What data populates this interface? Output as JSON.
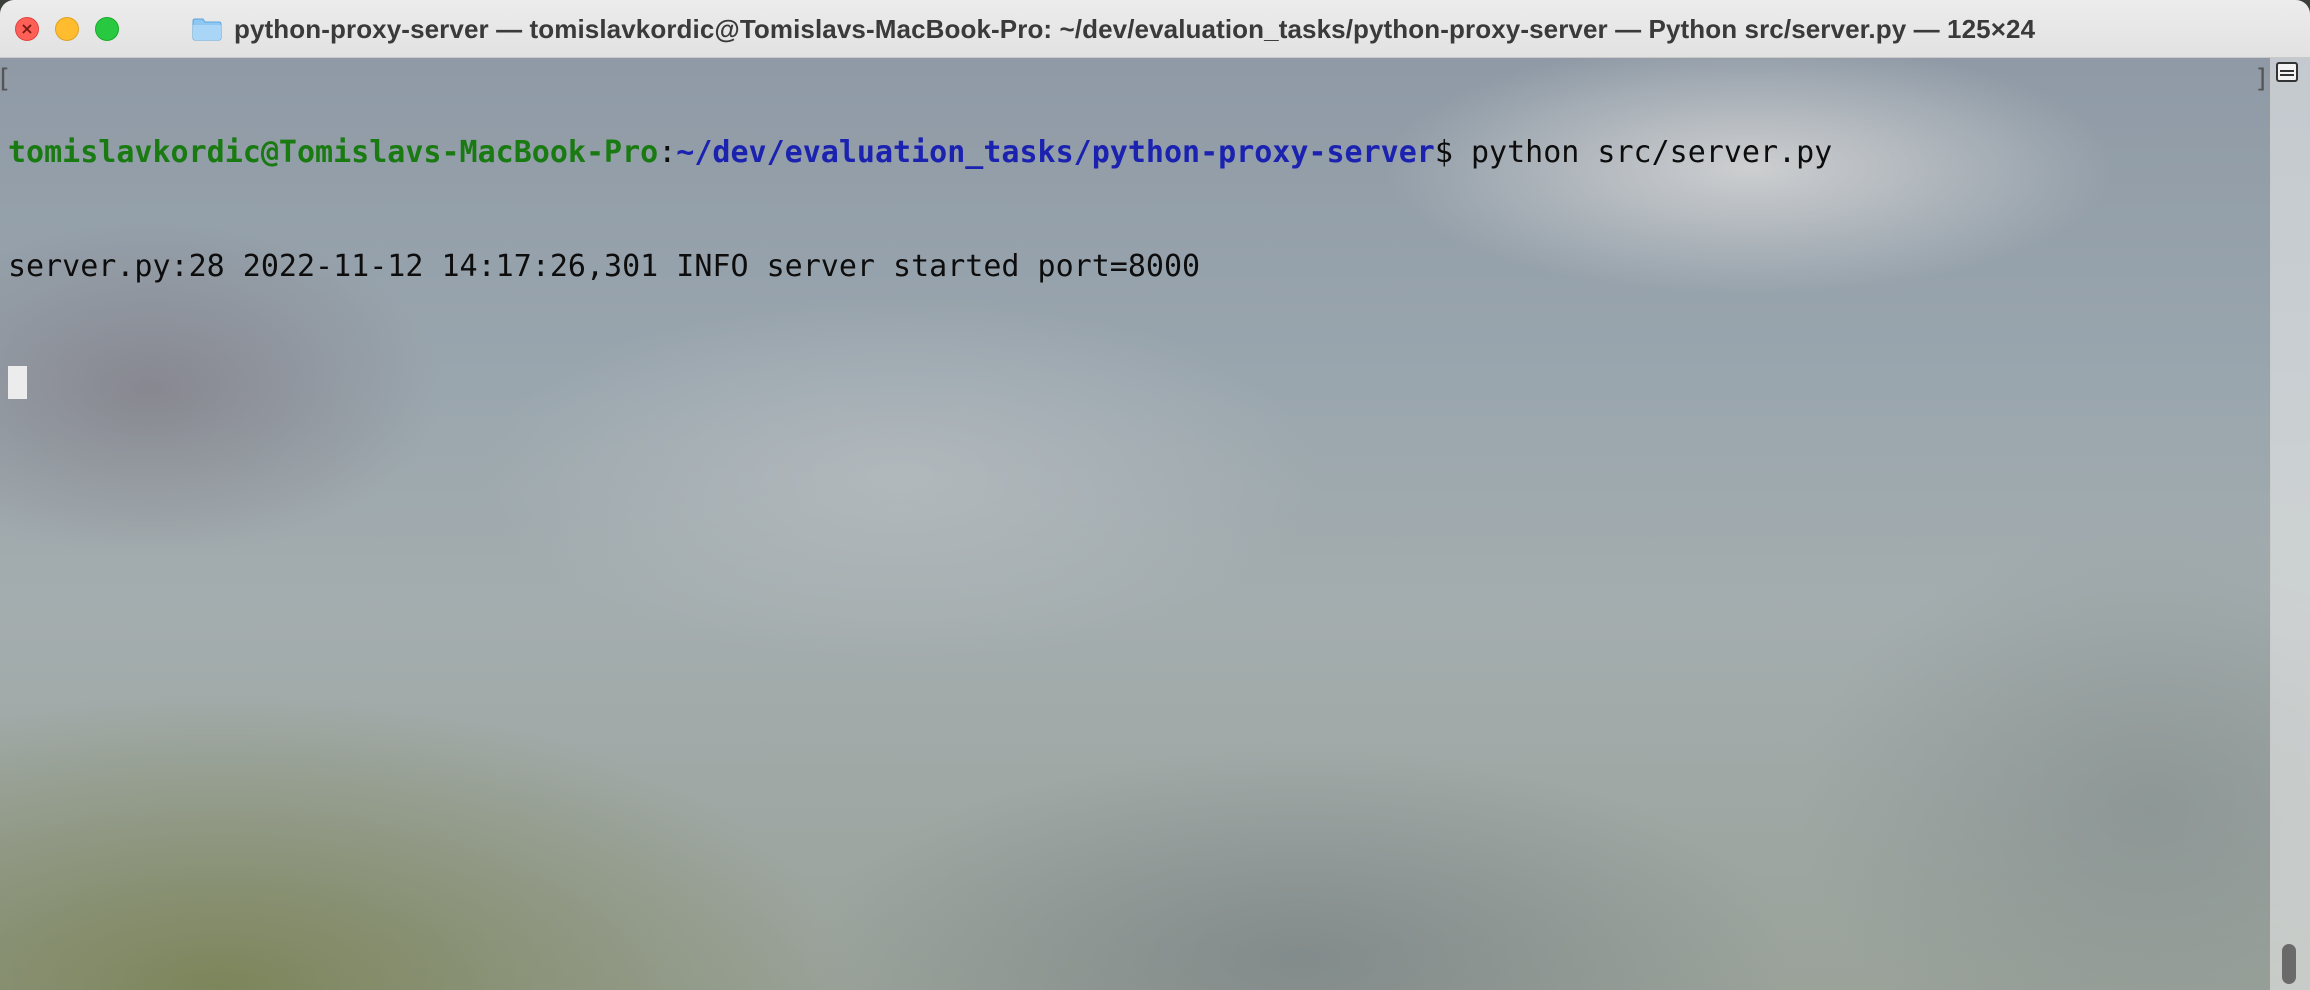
{
  "window": {
    "title": "python-proxy-server — tomislavkordic@Tomislavs-MacBook-Pro: ~/dev/evaluation_tasks/python-proxy-server — Python src/server.py — 125×24",
    "folder_icon": "folder-icon"
  },
  "traffic_lights": {
    "close_icon": "close-icon",
    "minimize_icon": "minimize-icon",
    "zoom_icon": "zoom-icon",
    "colors": {
      "close": "#fe5f57",
      "minimize": "#febc2e",
      "zoom": "#28c840"
    }
  },
  "terminal": {
    "prompt": {
      "user_host": "tomislavkordic@Tomislavs-MacBook-Pro",
      "separator": ":",
      "path": "~/dev/evaluation_tasks/python-proxy-server",
      "symbol": "$",
      "command": " python src/server.py"
    },
    "output_lines": [
      "server.py:28 2022-11-12 14:17:26,301 INFO server started port=8000"
    ],
    "colors": {
      "user_host": "#1a7a12",
      "path": "#1b22b0",
      "text": "#0d0d0d"
    }
  }
}
